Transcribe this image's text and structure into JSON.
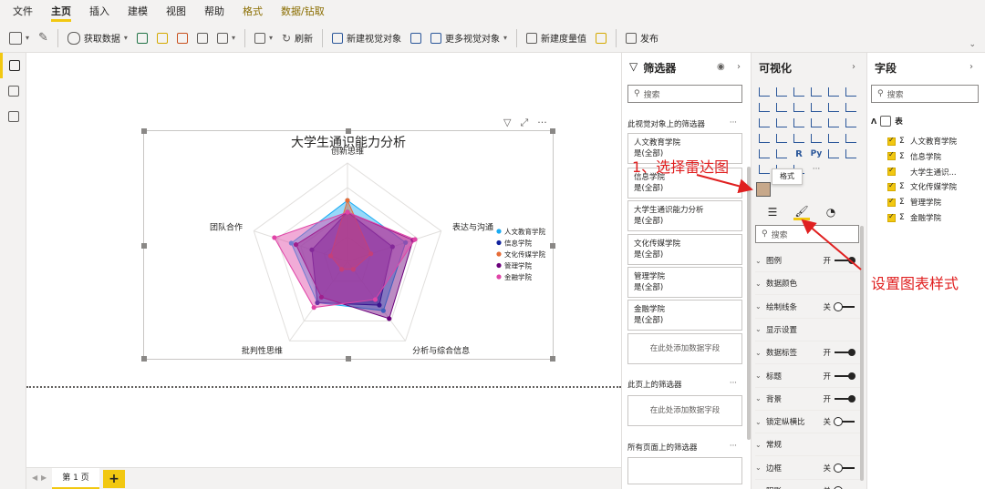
{
  "menu": [
    "文件",
    "主页",
    "插入",
    "建模",
    "视图",
    "帮助",
    "格式",
    "数据/钻取"
  ],
  "ribbon": {
    "get_data": "获取数据",
    "refresh": "刷新",
    "new_visual": "新建视觉对象",
    "more_visuals": "更多视觉对象",
    "new_measure": "新建度量值",
    "publish": "发布"
  },
  "page_tab": "第 1 页",
  "add_page": "+",
  "chart_data": {
    "type": "radar",
    "title": "大学生通识能力分析",
    "axes": [
      "创新思维",
      "表达与沟通",
      "分析与综合信息",
      "批判性思维",
      "团队合作"
    ],
    "series": [
      {
        "name": "人文教育学院",
        "color": "#1aabf2",
        "values": [
          0.62,
          0.62,
          0.62,
          0.52,
          0.6
        ]
      },
      {
        "name": "信息学院",
        "color": "#12239e",
        "values": [
          0.5,
          0.48,
          0.55,
          0.52,
          0.38
        ]
      },
      {
        "name": "文化传媒学院",
        "color": "#e66c37",
        "values": [
          0.62,
          0.25,
          0.1,
          0.1,
          0.18
        ]
      },
      {
        "name": "管理学院",
        "color": "#6b007b",
        "values": [
          0.5,
          0.7,
          0.72,
          0.45,
          0.55
        ]
      },
      {
        "name": "金融学院",
        "color": "#e044a7",
        "values": [
          0.5,
          0.72,
          0.48,
          0.58,
          0.78
        ]
      }
    ]
  },
  "filters": {
    "title": "筛选器",
    "search_placeholder": "搜索",
    "on_visual": "此视觉对象上的筛选器",
    "cards": [
      {
        "name": "人文教育学院",
        "value": "是(全部)"
      },
      {
        "name": "信息学院",
        "value": "是(全部)"
      },
      {
        "name": "大学生通识能力分析",
        "value": "是(全部)"
      },
      {
        "name": "文化传媒学院",
        "value": "是(全部)"
      },
      {
        "name": "管理学院",
        "value": "是(全部)"
      },
      {
        "name": "金融学院",
        "value": "是(全部)"
      }
    ],
    "add_field": "在此处添加数据字段",
    "on_page": "此页上的筛选器",
    "all_pages": "所有页面上的筛选器"
  },
  "visualizations": {
    "title": "可视化",
    "tooltip": "格式",
    "search_placeholder": "搜索",
    "props": [
      {
        "label": "图例",
        "toggle": "开",
        "on": true
      },
      {
        "label": "数据颜色",
        "toggle": "",
        "on": null
      },
      {
        "label": "绘制线条",
        "toggle": "关",
        "on": false
      },
      {
        "label": "显示设置",
        "toggle": "",
        "on": null
      },
      {
        "label": "数据标签",
        "toggle": "开",
        "on": true
      },
      {
        "label": "标题",
        "toggle": "开",
        "on": true
      },
      {
        "label": "背景",
        "toggle": "开",
        "on": true
      },
      {
        "label": "锁定纵横比",
        "toggle": "关",
        "on": false
      },
      {
        "label": "常规",
        "toggle": "",
        "on": null
      },
      {
        "label": "边框",
        "toggle": "关",
        "on": false
      },
      {
        "label": "阴影",
        "toggle": "关",
        "on": false
      }
    ]
  },
  "fields": {
    "title": "字段",
    "search_placeholder": "搜索",
    "table": "表",
    "items": [
      {
        "label": "人文教育学院",
        "sigma": "Σ"
      },
      {
        "label": "信息学院",
        "sigma": "Σ"
      },
      {
        "label": "大学生通识...",
        "sigma": ""
      },
      {
        "label": "文化传媒学院",
        "sigma": "Σ"
      },
      {
        "label": "管理学院",
        "sigma": "Σ"
      },
      {
        "label": "金融学院",
        "sigma": "Σ"
      }
    ]
  },
  "annotations": {
    "select_radar": "1、选择雷达图",
    "set_style": "设置图表样式"
  },
  "text_icons": {
    "r": "R",
    "py": "Py",
    "more": "···"
  }
}
